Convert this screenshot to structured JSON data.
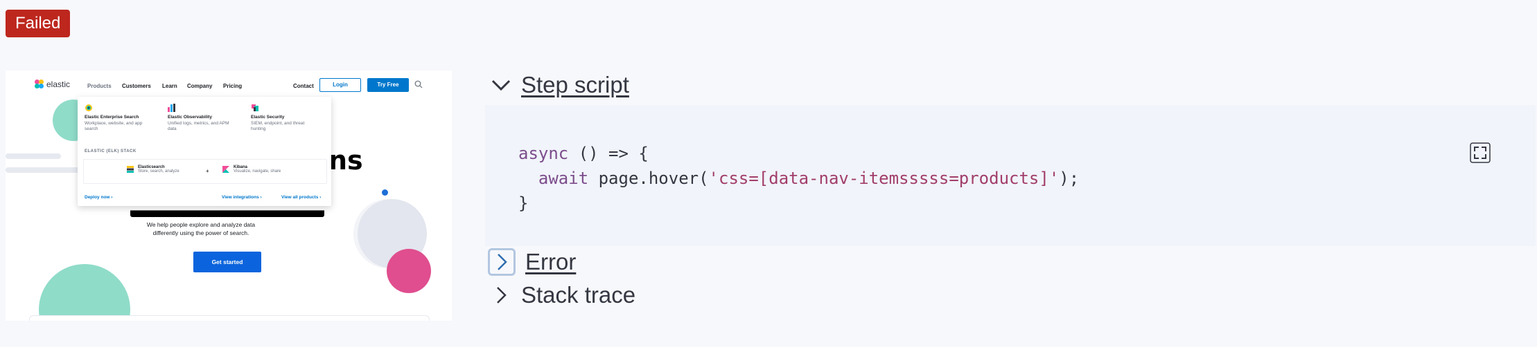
{
  "status_badge": "Failed",
  "screenshot": {
    "logo_text": "elastic",
    "nav": {
      "products": "Products",
      "customers": "Customers",
      "learn": "Learn",
      "company": "Company",
      "pricing": "Pricing",
      "contact": "Contact",
      "login": "Login",
      "try_free": "Try Free"
    },
    "dropdown": {
      "products": [
        {
          "name": "Elastic Enterprise Search",
          "desc": "Workplace, website, and app search"
        },
        {
          "name": "Elastic Observability",
          "desc": "Unified logs, metrics, and APM data"
        },
        {
          "name": "Elastic Security",
          "desc": "SIEM, endpoint, and threat hunting"
        }
      ],
      "stack_label": "ELASTIC (ELK) STACK",
      "stack_items": [
        {
          "name": "Elasticsearch",
          "desc": "Store, search, analyze"
        },
        {
          "name": "Kibana",
          "desc": "Visualize, navigate, share"
        }
      ],
      "plus": "+",
      "deploy_now": "Deploy now",
      "view_integrations": "View integrations",
      "view_all_products": "View all products"
    },
    "hero_title_right": "ns",
    "hero_text": "We help people explore and analyze data differently using the power of search.",
    "get_started": "Get started"
  },
  "step_script": {
    "title": "Step script",
    "code_lines": {
      "l1_kw": "async",
      "l1_rest": " () => {",
      "l2_indent": "  ",
      "l2_kw": "await",
      "l2_mid": " page.hover(",
      "l2_str": "'css=[data-nav-itemsssss=products]'",
      "l2_end": ");",
      "l3": "}"
    }
  },
  "error": {
    "title": "Error"
  },
  "stack_trace": {
    "title": "Stack trace"
  },
  "colors": {
    "failed": "#bd271e",
    "keyword": "#7c4d8c",
    "string": "#a23e6b",
    "accent": "#0077cc"
  }
}
